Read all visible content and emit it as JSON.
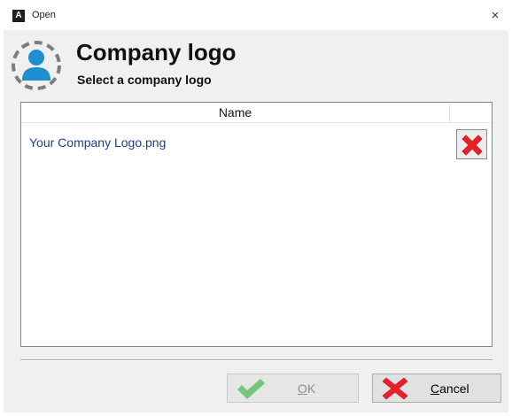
{
  "window": {
    "title": "Open",
    "app_icon_letter": "A",
    "close_glyph": "×"
  },
  "header": {
    "title": "Company logo",
    "subtitle": "Select a company logo",
    "icon": "user-icon"
  },
  "list": {
    "columns": [
      "Name"
    ],
    "rows": [
      {
        "name": "Your Company Logo.png",
        "action_icon": "delete-x-icon"
      }
    ]
  },
  "buttons": {
    "ok": {
      "accel": "O",
      "rest": "K",
      "enabled": false,
      "icon": "checkmark-icon"
    },
    "cancel": {
      "accel": "C",
      "rest": "ancel",
      "enabled": true,
      "icon": "cross-icon"
    }
  },
  "colors": {
    "accent_blue": "#1d8fd0",
    "delete_red": "#e8202a",
    "ok_green": "#77c47a",
    "row_text": "#1e3e8a"
  }
}
